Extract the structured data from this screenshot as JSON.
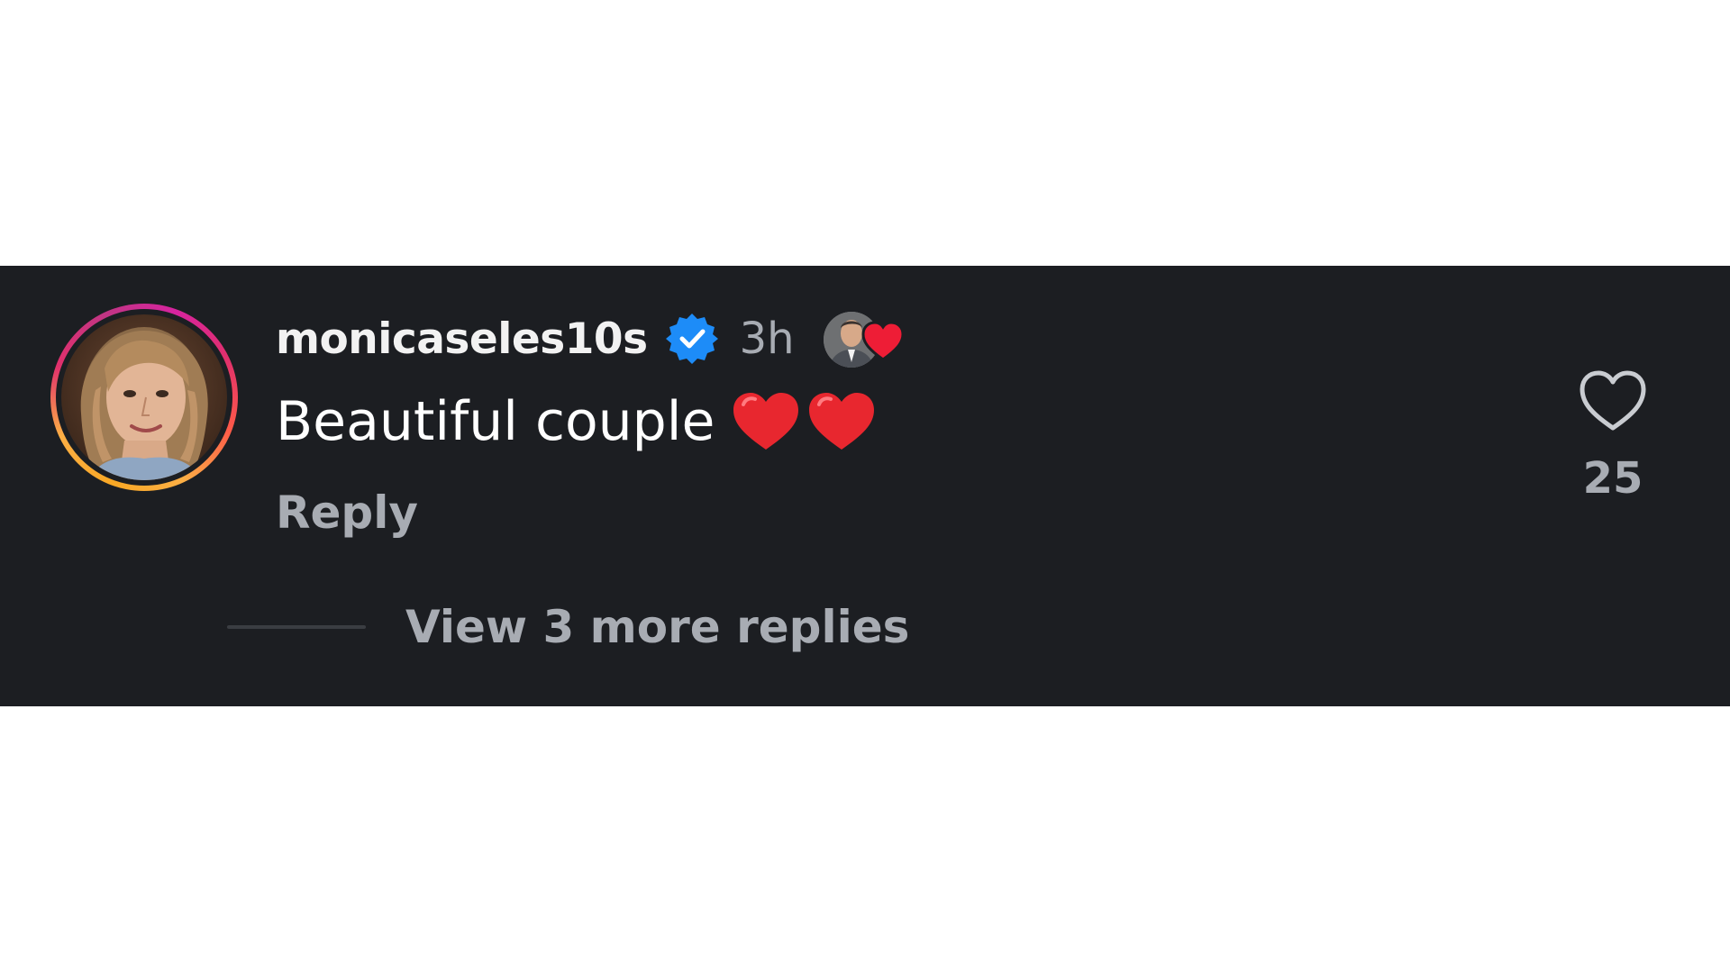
{
  "comment": {
    "username": "monicaseles10s",
    "verified": true,
    "timestamp": "3h",
    "text": "Beautiful couple",
    "text_emoji": [
      "red-heart",
      "red-heart"
    ],
    "reply_label": "Reply",
    "like_count": "25",
    "view_replies_label": "View 3 more replies",
    "liked_by_author_icon": "author-avatar-with-heart"
  },
  "colors": {
    "panel_bg": "#1c1e22",
    "page_bg": "#ffffff",
    "username": "#f2f2f2",
    "secondary_text": "#a8acb3",
    "verified_blue": "#1d8cf8",
    "heart_red": "#ee1d36"
  },
  "icons": {
    "verified": "verified-badge-icon",
    "like": "heart-outline-icon",
    "emoji": "red-heart-emoji-icon"
  }
}
